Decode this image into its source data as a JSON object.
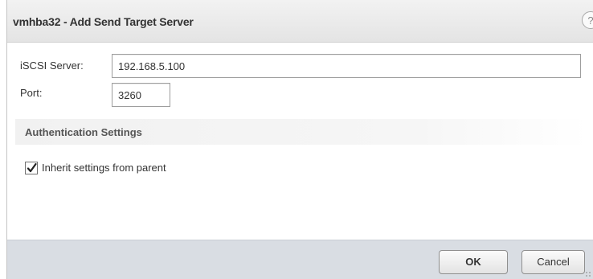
{
  "dialog": {
    "title": "vmhba32 - Add Send Target Server",
    "help_icon": "?"
  },
  "form": {
    "server_label": "iSCSI Server:",
    "server_value": "192.168.5.100",
    "port_label": "Port:",
    "port_value": "3260"
  },
  "authentication": {
    "section_title": "Authentication Settings",
    "inherit_label": "Inherit settings from parent",
    "inherit_checked": true
  },
  "footer": {
    "ok_label": "OK",
    "cancel_label": "Cancel"
  },
  "icons": {
    "help": "help-icon",
    "check": "checkmark-icon",
    "resize": "resize-grip-icon"
  }
}
